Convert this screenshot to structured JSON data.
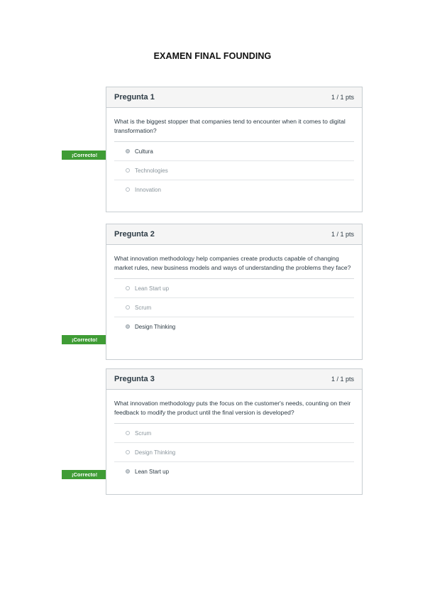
{
  "document": {
    "title": "EXAMEN FINAL FOUNDING"
  },
  "questions": [
    {
      "title": "Pregunta 1",
      "points": "1 / 1 pts",
      "text": "What is the biggest stopper that companies tend to encounter when it comes to digital transformation?",
      "answers": [
        "Cultura",
        "Technologies",
        "Innovation"
      ],
      "selected_index": 0,
      "badge": "¡Correcto!"
    },
    {
      "title": "Pregunta 2",
      "points": "1 / 1 pts",
      "text": "What innovation methodology help companies create products capable of changing market rules, new business models and ways of understanding the problems they face?",
      "answers": [
        "Lean Start up",
        "Scrum",
        "Design Thinking"
      ],
      "selected_index": 2,
      "badge": "¡Correcto!"
    },
    {
      "title": "Pregunta 3",
      "points": "1 / 1 pts",
      "text": "What innovation methodology puts the focus on the customer's needs, counting on their feedback to modify the product until the final version is developed?",
      "answers": [
        "Scrum",
        "Design Thinking",
        "Lean Start up"
      ],
      "selected_index": 2,
      "badge": "¡Correcto!"
    }
  ]
}
